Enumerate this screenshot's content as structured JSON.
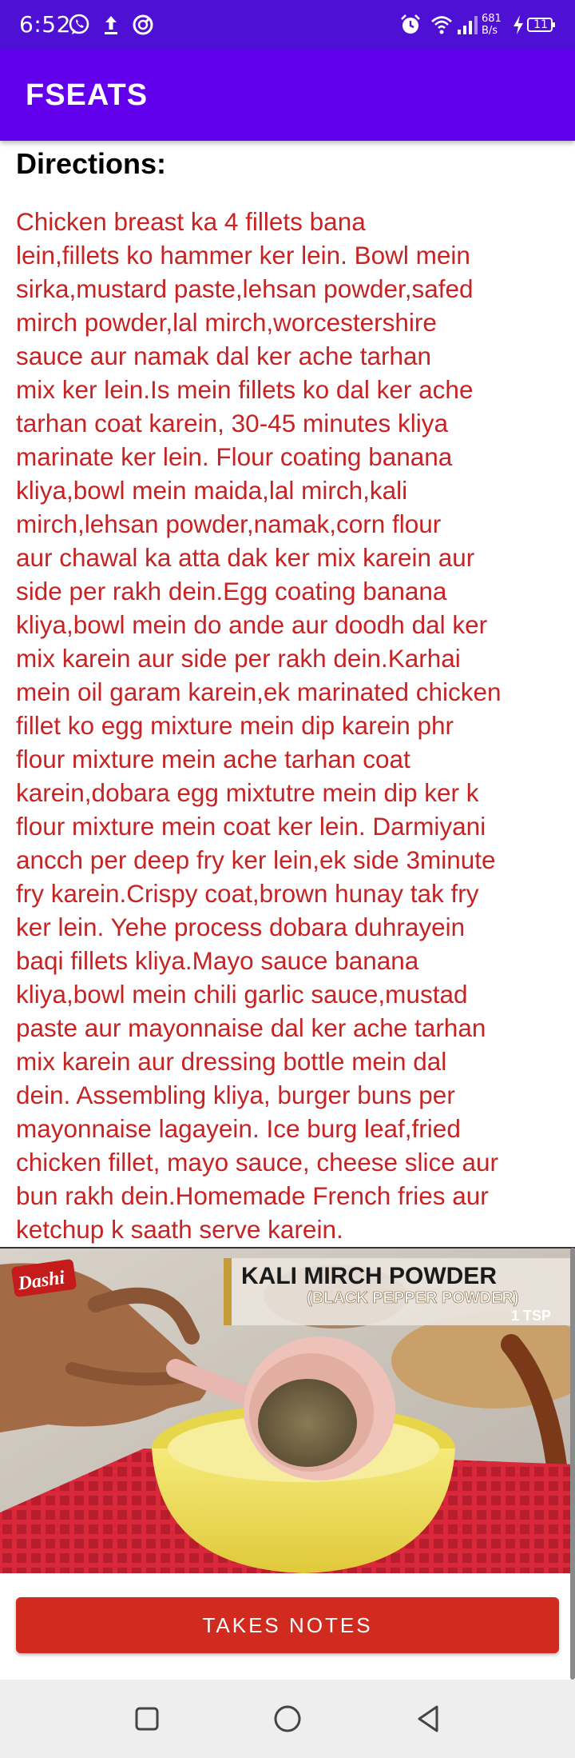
{
  "status_bar": {
    "time": "6:52",
    "net_speed_value": "681",
    "net_speed_unit": "B/s",
    "battery": "11"
  },
  "app_bar": {
    "title": "FSEATS"
  },
  "recipe": {
    "directions_heading": "Directions:",
    "directions_text": "Chicken breast ka 4 fillets bana\nlein,fillets ko hammer ker lein. Bowl mein\nsirka,mustard paste,lehsan powder,safed\nmirch powder,lal mirch,worcestershire\nsauce aur namak dal ker ache tarhan\nmix ker lein.Is mein fillets ko dal ker ache\ntarhan coat karein, 30-45 minutes kliya\nmarinate ker lein. Flour coating banana\nkliya,bowl mein maida,lal mirch,kali\nmirch,lehsan powder,namak,corn flour\naur chawal ka atta dak ker mix karein aur\nside per rakh dein.Egg coating banana\nkliya,bowl mein do ande aur doodh dal ker\nmix karein aur side per rakh dein.Karhai\nmein oil garam karein,ek marinated chicken\nfillet ko egg mixture mein dip karein phr\nflour mixture mein ache tarhan coat\nkarein,dobara egg mixtutre mein dip ker k\nflour mixture mein coat ker lein. Darmiyani\nancch per deep fry ker lein,ek side 3minute\nfry karein.Crispy coat,brown hunay tak fry\nker lein. Yehe process dobara duhrayein\nbaqi fillets kliya.Mayo sauce banana\nkliya,bowl mein chili garlic sauce,mustad\npaste aur mayonnaise dal ker ache tarhan\nmix karein aur dressing bottle mein dal\ndein. Assembling kliya, burger buns per\nmayonnaise lagayein. Ice burg leaf,fried\nchicken fillet, mayo sauce, cheese slice aur\nbun rakh dein.Homemade French fries aur\nketchup k saath serve karein."
  },
  "video": {
    "brand_logo": "Dashi",
    "caption_title": "KALI MIRCH POWDER",
    "caption_subtitle": "(BLACK PEPPER POWDER)",
    "caption_qty": "1 TSP"
  },
  "actions": {
    "takes_notes_label": "TAKES NOTES"
  },
  "nav": {
    "icons": [
      "recents-square-icon",
      "home-circle-icon",
      "back-triangle-icon"
    ]
  },
  "colors": {
    "status_bar": "#4e10d2",
    "app_bar": "#6200ee",
    "directions_text": "#c62424",
    "button": "#d12a1f"
  }
}
